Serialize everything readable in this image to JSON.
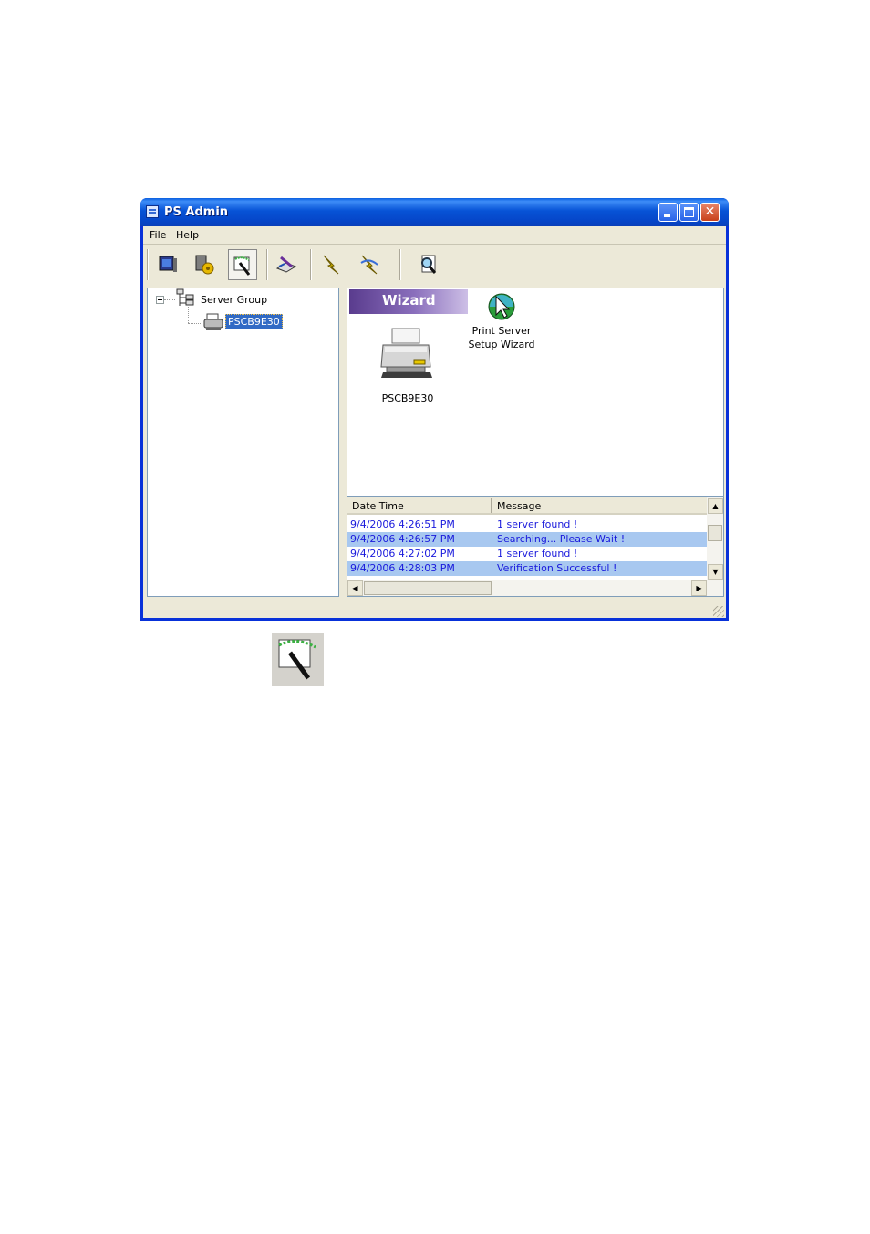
{
  "window": {
    "title": "PS Admin"
  },
  "menu": {
    "items": [
      "File",
      "Help"
    ]
  },
  "toolbar": {
    "icons": [
      "monitor-icon",
      "server-settings-icon",
      "wizard-wand-icon",
      "edit-properties-icon",
      "connect-icon",
      "disconnect-icon",
      "search-icon"
    ]
  },
  "tree": {
    "root_label": "Server Group",
    "child_label": "PSCB9E30"
  },
  "main": {
    "banner": "Wizard",
    "printer_label": "PSCB9E30",
    "wizard_label_line1": "Print Server",
    "wizard_label_line2": "Setup Wizard"
  },
  "log": {
    "columns": [
      "Date Time",
      "Message"
    ],
    "rows": [
      {
        "time": "9/4/2006 4:26:51 PM",
        "message": "1 server found !"
      },
      {
        "time": "9/4/2006 4:26:57 PM",
        "message": "Searching... Please Wait !"
      },
      {
        "time": "9/4/2006 4:27:02 PM",
        "message": "1 server found !"
      },
      {
        "time": "9/4/2006 4:28:03 PM",
        "message": "Verification Successful !"
      }
    ]
  },
  "colors": {
    "titlebar": "#0753d6",
    "selection": "#316ac5",
    "log_text": "#1a1adc",
    "log_highlight": "#a8c8f0",
    "banner": "#8a6fbc"
  }
}
